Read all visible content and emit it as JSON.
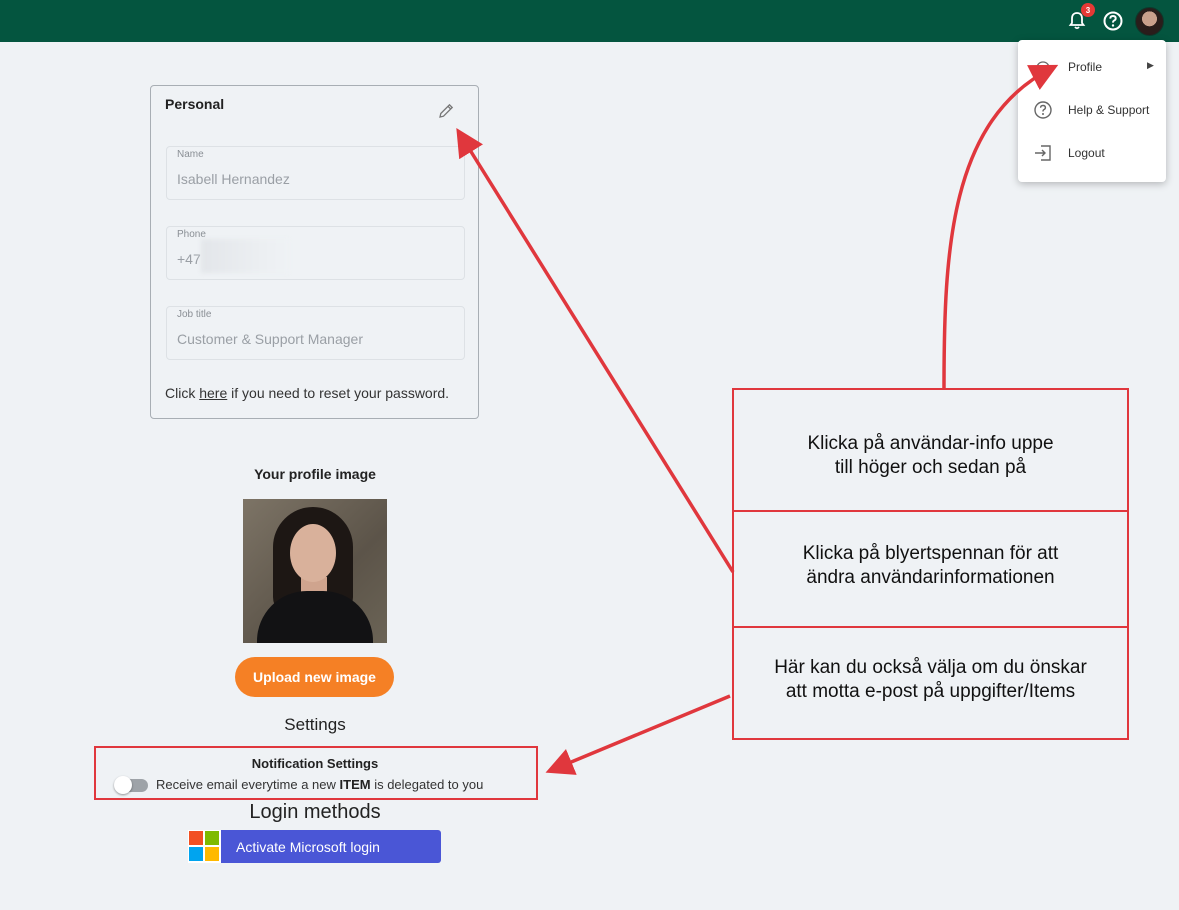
{
  "header": {
    "notification_count": "3",
    "icons": [
      "bell-icon",
      "help-icon",
      "avatar"
    ]
  },
  "user_menu": {
    "items": [
      {
        "label": "Profile",
        "icon": "profile-icon",
        "has_submenu": true
      },
      {
        "label": "Help & Support",
        "icon": "help-circle-icon"
      },
      {
        "label": "Logout",
        "icon": "logout-icon"
      }
    ]
  },
  "personal": {
    "title": "Personal",
    "fields": [
      {
        "label": "Name",
        "value": "Isabell Hernandez"
      },
      {
        "label": "Phone",
        "value": "+47"
      },
      {
        "label": "Job title",
        "value": "Customer & Support Manager"
      }
    ],
    "reset_prefix": "Click ",
    "reset_link": "here",
    "reset_suffix": " if you need to reset your password."
  },
  "profile_image": {
    "label": "Your profile image",
    "upload_button": "Upload new image"
  },
  "settings": {
    "heading": "Settings",
    "notification_title": "Notification Settings",
    "email_toggle_prefix": "Receive email everytime a new ",
    "email_toggle_bold": "ITEM",
    "email_toggle_suffix": " is delegated to you",
    "email_toggle_on": false
  },
  "login": {
    "heading": "Login methods",
    "microsoft_button": "Activate Microsoft login"
  },
  "annotations": {
    "callout_1_line1": "Klicka på användar-info uppe",
    "callout_1_line2": "till höger och sedan på",
    "callout_2_line1": "Klicka på blyertspennan för att",
    "callout_2_line2": "ändra användarinformationen",
    "callout_3_line1": "Här kan du också välja om du önskar",
    "callout_3_line2": "att motta e-post på uppgifter/Items",
    "color": "#e0373d"
  },
  "colors": {
    "header": "#04553f",
    "accent_orange": "#f58025",
    "microsoft_button": "#4a56d6",
    "background": "#eff2f5"
  }
}
